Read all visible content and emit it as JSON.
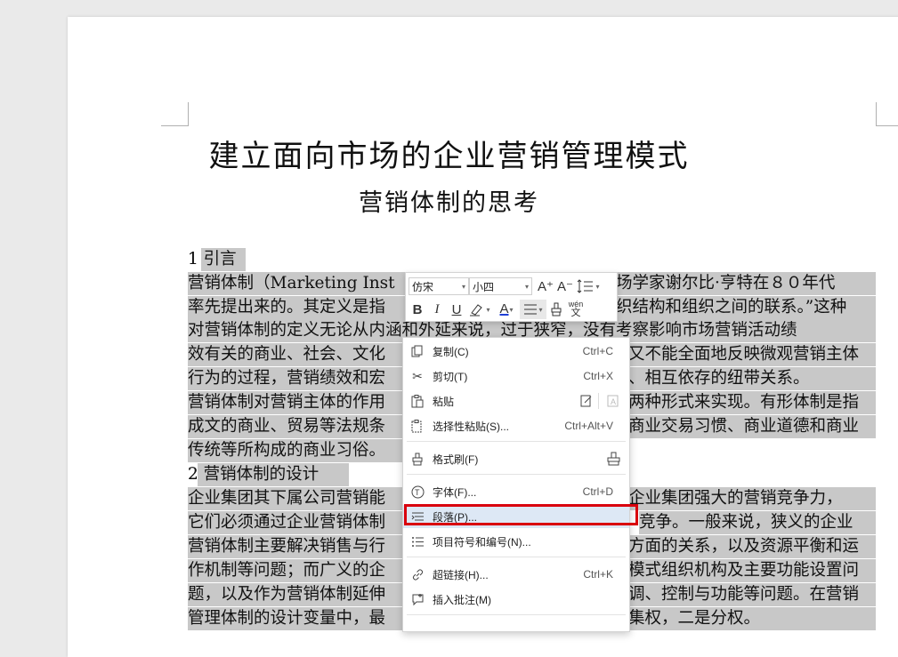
{
  "document": {
    "title": "建立面向市场的企业营销管理模式",
    "subtitle": "营销体制的思考",
    "lines": [
      {
        "text": "1 引言"
      },
      {
        "text": "营销体制（Marketing Inst"
      },
      {
        "text": "率先提出来的。其定义是指"
      },
      {
        "text": "对营销体制的定义无论从内涵和外延来说，过于狭窄，没有考察影响市场营销活动绩"
      },
      {
        "text": "效有关的商业、社会、文化"
      },
      {
        "text": "行为的过程，营销绩效和宏"
      },
      {
        "text": "营销体制对营销主体的作用"
      },
      {
        "text": "成文的商业、贸易等法规条"
      },
      {
        "text": "传统等所构成的商业习俗。"
      },
      {
        "text": "2 营销体制的设计"
      },
      {
        "text": "企业集团其下属公司营销能"
      },
      {
        "text": "它们必须通过企业营销体制"
      },
      {
        "text": "营销体制主要解决销售与行"
      },
      {
        "text": "作机制等问题；而广义的企"
      },
      {
        "text": "题，以及作为营销体制延伸"
      },
      {
        "text": "管理体制的设计变量中，最"
      }
    ],
    "right_fragments": [
      {
        "text": "场学家谢尔比·亨特在８０年代"
      },
      {
        "text": "织结构和组织之间的联系。”这种"
      },
      {
        "text": "又不能全面地反映微观营销主体"
      },
      {
        "text": "、相互依存的纽带关系。"
      },
      {
        "text": "两种形式来实现。有形体制是指"
      },
      {
        "text": "商业交易习惯、商业道德和商业"
      },
      {
        "text": "企业集团强大的营销竞争力，"
      },
      {
        "text": "竞争。一般来说，狭义的企业"
      },
      {
        "text": "方面的关系，以及资源平衡和运"
      },
      {
        "text": "模式组织机构及主要功能设置问"
      },
      {
        "text": "调、控制与功能等问题。在营销"
      },
      {
        "text": "集权，二是分权。"
      }
    ]
  },
  "mini_toolbar": {
    "font_name": "仿宋",
    "font_size": "小四",
    "grow_font": "A⁺",
    "shrink_font": "A⁻",
    "bold": "B",
    "italic": "I",
    "underline": "U",
    "font_color_letter": "A",
    "pinyin": "wén"
  },
  "context_menu": {
    "items": [
      {
        "label": "复制(C)",
        "shortcut": "Ctrl+C",
        "icon": "copy-icon"
      },
      {
        "label": "剪切(T)",
        "shortcut": "Ctrl+X",
        "icon": "scissors-icon"
      },
      {
        "label": "粘贴",
        "shortcut": "",
        "icon": "paste-icon"
      },
      {
        "label": "选择性粘贴(S)...",
        "shortcut": "Ctrl+Alt+V",
        "icon": "paste-special-icon"
      },
      {
        "label": "格式刷(F)",
        "shortcut": "",
        "icon": "format-painter-icon"
      },
      {
        "label": "字体(F)...",
        "shortcut": "Ctrl+D",
        "icon": "font-icon"
      },
      {
        "label": "段落(P)...",
        "shortcut": "",
        "icon": "paragraph-icon"
      },
      {
        "label": "项目符号和编号(N)...",
        "shortcut": "",
        "icon": "list-icon"
      },
      {
        "label": "超链接(H)...",
        "shortcut": "Ctrl+K",
        "icon": "link-icon"
      },
      {
        "label": "插入批注(M)",
        "shortcut": "",
        "icon": "comment-icon"
      }
    ]
  },
  "colors": {
    "selection": "#c8c8c8",
    "highlight_box": "#d9000d",
    "font_color_bar": "#1f3fd6"
  }
}
